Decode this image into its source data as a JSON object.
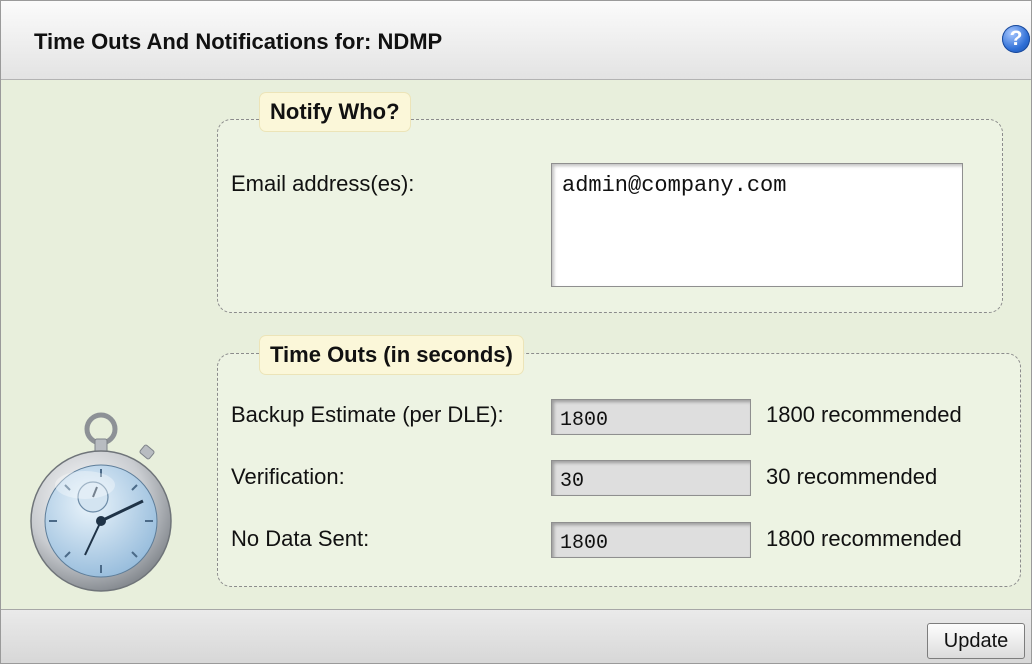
{
  "dialog": {
    "title": "Time Outs And Notifications for: NDMP",
    "help_icon": "question-mark-icon",
    "help_glyph": "?"
  },
  "notify": {
    "legend": "Notify Who?",
    "email_label": "Email address(es):",
    "email_value": "admin@company.com"
  },
  "timeouts": {
    "legend": "Time Outs (in seconds)",
    "rows": [
      {
        "label": "Backup Estimate (per DLE):",
        "value": "1800",
        "recommended": "1800 recommended"
      },
      {
        "label": "Verification:",
        "value": "30",
        "recommended": "30 recommended"
      },
      {
        "label": "No Data Sent:",
        "value": "1800",
        "recommended": "1800 recommended"
      }
    ],
    "illustration_icon": "stopwatch-icon"
  },
  "footer": {
    "update_label": "Update"
  },
  "colors": {
    "panel_background": "#e8efdc",
    "legend_background": "#fbf7d9",
    "help_blue": "#2f6fd6"
  }
}
